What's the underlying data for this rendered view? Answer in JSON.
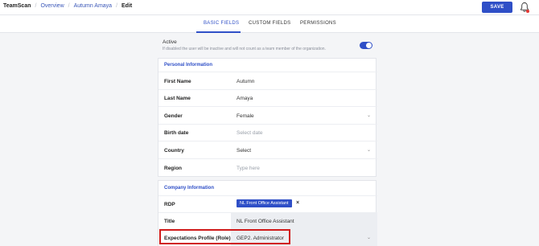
{
  "breadcrumb": [
    "TeamScan",
    "Overview",
    "Autumn Amaya",
    "Edit"
  ],
  "header": {
    "save_label": "SAVE"
  },
  "tabs": [
    "BASIC FIELDS",
    "CUSTOM FIELDS",
    "PERMISSIONS"
  ],
  "active_tab": "BASIC FIELDS",
  "active_setting": {
    "label": "Active",
    "help": "If disabled the user will be inactive and will not count as a team member of the organization.",
    "enabled": true
  },
  "personal": {
    "title": "Personal Information",
    "first_name": {
      "label": "First Name",
      "value": "Autumn"
    },
    "last_name": {
      "label": "Last Name",
      "value": "Amaya"
    },
    "gender": {
      "label": "Gender",
      "value": "Female"
    },
    "birth_date": {
      "label": "Birth date",
      "placeholder": "Select date"
    },
    "country": {
      "label": "Country",
      "value": "Select"
    },
    "region": {
      "label": "Region",
      "placeholder": "Type here"
    }
  },
  "company": {
    "title": "Company Information",
    "rdp": {
      "label": "RDP",
      "chip": "NL Front Office Assistant",
      "remove": "×"
    },
    "title_field": {
      "label": "Title",
      "value": "NL Front Office Assistant"
    },
    "expectations": {
      "label": "Expectations Profile (Role)",
      "value": "GEP2. Administrator"
    }
  },
  "colors": {
    "accent": "#2f4fc7",
    "highlight": "#d01a1a",
    "notification": "#e53935"
  }
}
